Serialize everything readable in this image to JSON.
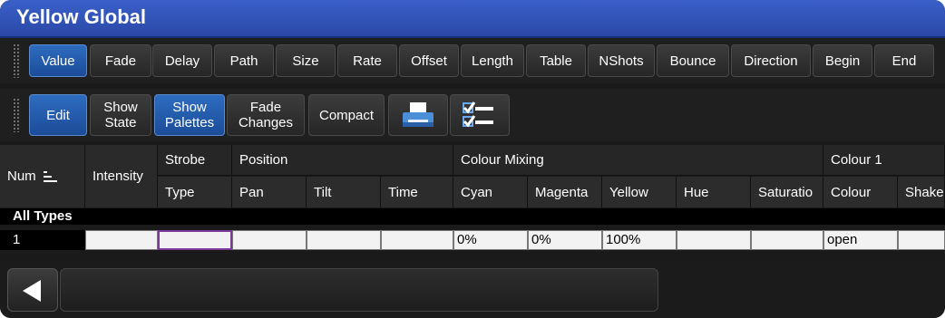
{
  "window": {
    "title": "Yellow Global"
  },
  "toolbar1": {
    "items": [
      "Value",
      "Fade",
      "Delay",
      "Path",
      "Size",
      "Rate",
      "Offset",
      "Length",
      "Table",
      "NShots",
      "Bounce",
      "Direction",
      "Begin",
      "End"
    ]
  },
  "toolbar2": {
    "edit": "Edit",
    "show_state": [
      "Show",
      "State"
    ],
    "show_palettes": [
      "Show",
      "Palettes"
    ],
    "fade_changes": [
      "Fade",
      "Changes"
    ],
    "compact": "Compact",
    "icons": [
      "printer-icon",
      "checklist-icon"
    ]
  },
  "grid": {
    "num_header": "Num",
    "intensity_header": "Intensity",
    "groups": [
      "Strobe",
      "Position",
      "Colour Mixing",
      "Colour 1"
    ],
    "subheaders": [
      "Type",
      "Pan",
      "Tilt",
      "Time",
      "Cyan",
      "Magenta",
      "Yellow",
      "Hue",
      "Saturatio",
      "Colour",
      "Shake"
    ]
  },
  "section": {
    "label": "All Types"
  },
  "row": {
    "num": "1",
    "values": [
      "",
      "",
      "",
      "",
      "",
      "0%",
      "0%",
      "100%",
      "",
      "",
      "open",
      ""
    ]
  }
}
